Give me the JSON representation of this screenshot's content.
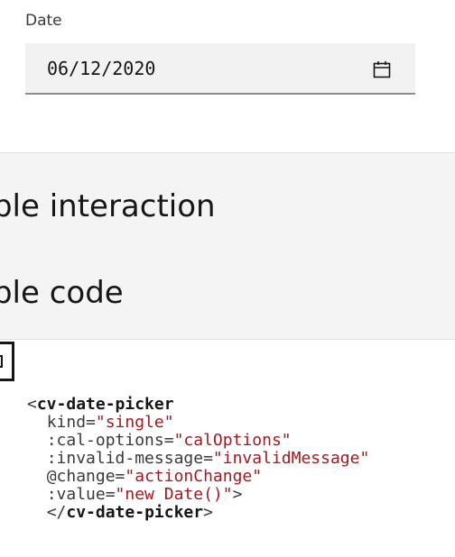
{
  "date_picker": {
    "label": "Date",
    "value": "06/12/2020",
    "calendar_icon": "calendar-icon"
  },
  "sample": {
    "interaction_heading": "ample interaction",
    "code_heading": "ample code"
  },
  "code": {
    "copy_icon": "copy-icon",
    "open_lt": "<",
    "tag_name": "cv-date-picker",
    "indent": "  ",
    "attr1": "kind=",
    "val1": "\"single\"",
    "attr2": ":cal-options=",
    "val2": "\"calOptions\"",
    "attr3": ":invalid-message=",
    "val3": "\"invalidMessage\"",
    "attr4": "@change=",
    "val4": "\"actionChange\"",
    "attr5": ":value=",
    "val5": "\"new Date()\"",
    "gt": ">",
    "close_lt": "</",
    "close_gt": ">"
  },
  "colors": {
    "field_bg": "#f2f2f2",
    "band_bg": "#f4f4f4",
    "string_red": "#a2191f",
    "text": "#161616"
  }
}
